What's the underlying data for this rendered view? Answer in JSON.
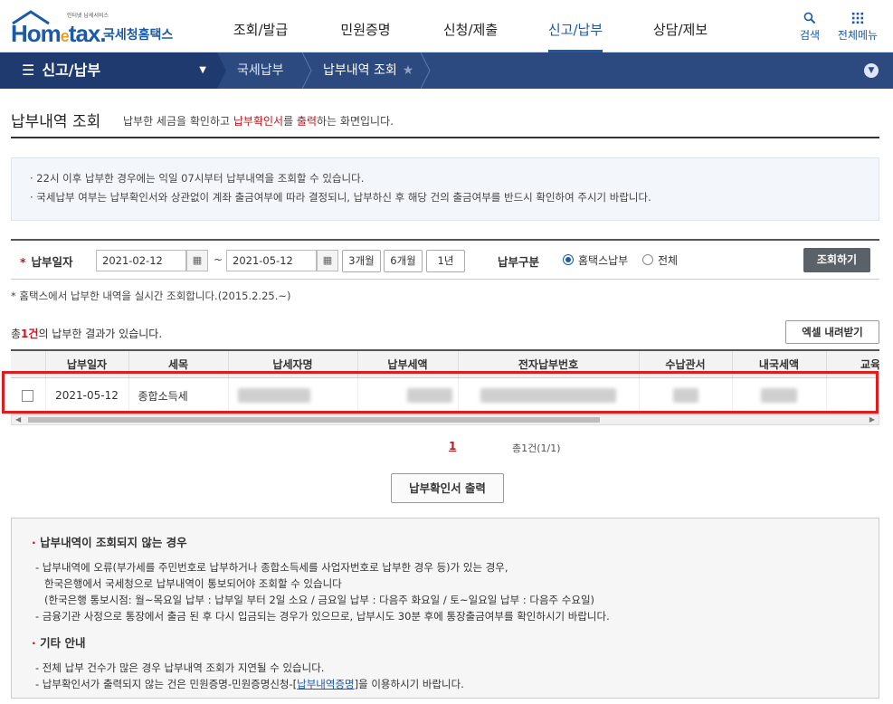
{
  "header": {
    "logo_small": "인터넷 납세서비스",
    "logo_main": "Hom",
    "logo_e": "e",
    "logo_main2": "tax.",
    "logo_kor": "국세청홈택스",
    "nav": [
      "조회/발급",
      "민원증명",
      "신청/제출",
      "신고/납부",
      "상담/제보"
    ],
    "active_nav": "신고/납부",
    "search_label": "검색",
    "menu_label": "전체메뉴"
  },
  "locbar": {
    "menu_title": "신고/납부",
    "crumb1": "국세납부",
    "crumb2": "납부내역 조회"
  },
  "page": {
    "title": "납부내역 조회",
    "desc_pre": "납부한 세금을 확인하고 ",
    "desc_red": "납부확인서",
    "desc_mid": "를 ",
    "desc_red2": "출력",
    "desc_post": "하는 화면입니다."
  },
  "info": [
    "· 22시 이후 납부한 경우에는 익일 07시부터 납부내역을 조회할 수 있습니다.",
    "· 국세납부 여부는 납부확인서와 상관없이 계좌 출금여부에 따라 결정되니, 납부하신 후 해당 건의 출금여부를 반드시 확인하여 주시기 바랍니다."
  ],
  "search": {
    "date_label": "납부일자",
    "date_from": "2021-02-12",
    "date_to": "2021-05-12",
    "tilde": "~",
    "periods": [
      "3개월",
      "6개월",
      "1년"
    ],
    "type_label": "납부구분",
    "radio_options": [
      "홈택스납부",
      "전체"
    ],
    "selected_radio": "홈택스납부",
    "submit": "조회하기"
  },
  "note": "* 홈택스에서 납부한 내역을 실시간 조회합니다.(2015.2.25.~)",
  "result": {
    "pre": "총",
    "count": "1건",
    "post": "의 납부한 결과가 있습니다.",
    "excel_button": "엑셀 내려받기"
  },
  "table": {
    "columns": [
      "",
      "납부일자",
      "세목",
      "납세자명",
      "납부세액",
      "전자납부번호",
      "수납관서",
      "내국세액",
      "교육세"
    ],
    "rows": [
      {
        "date": "2021-05-12",
        "tax_item": "종합소득세"
      }
    ]
  },
  "pager": {
    "current": "1",
    "total_text": "총1건(1/1)"
  },
  "print_button": "납부확인서 출력",
  "guide": {
    "sec1_title": "납부내역이 조회되지 않는 경우",
    "sec1_lines": [
      "- 납부내역에 오류(부가세를 주민번호로 납부하거나 종합소득세를 사업자번호로 납부한 경우 등)가 있는 경우,",
      "한국은행에서 국세청으로 납부내역이 통보되어야 조회할 수 있습니다",
      "(한국은행 통보시점: 월~목요일 납부 : 납부일 부터 2일 소요 / 금요일 납부 : 다음주 화요일 / 토~일요일 납부 : 다음주 수요일)",
      "- 금융기관 사정으로 통장에서 출금 된 후 다시 입금되는 경우가 있으므로, 납부시도 30분 후에 통장출금여부를 확인하시기 바랍니다."
    ],
    "sec2_title": "기타 안내",
    "sec2_line1": "- 전체 납부 건수가 많은 경우 납부내역 조회가 지연될 수 있습니다.",
    "sec2_line2_pre": "- 납부확인서가 출력되지 않는 건은 민원증명-민원증명신청-[",
    "sec2_line2_link": "납부내역증명",
    "sec2_line2_post": "]을 이용하시기 바랍니다."
  },
  "colors": {
    "brand": "#1a5aa8",
    "nav_bar": "#2c4a80",
    "highlight": "#e11c1c",
    "red_text": "#c4171d"
  }
}
